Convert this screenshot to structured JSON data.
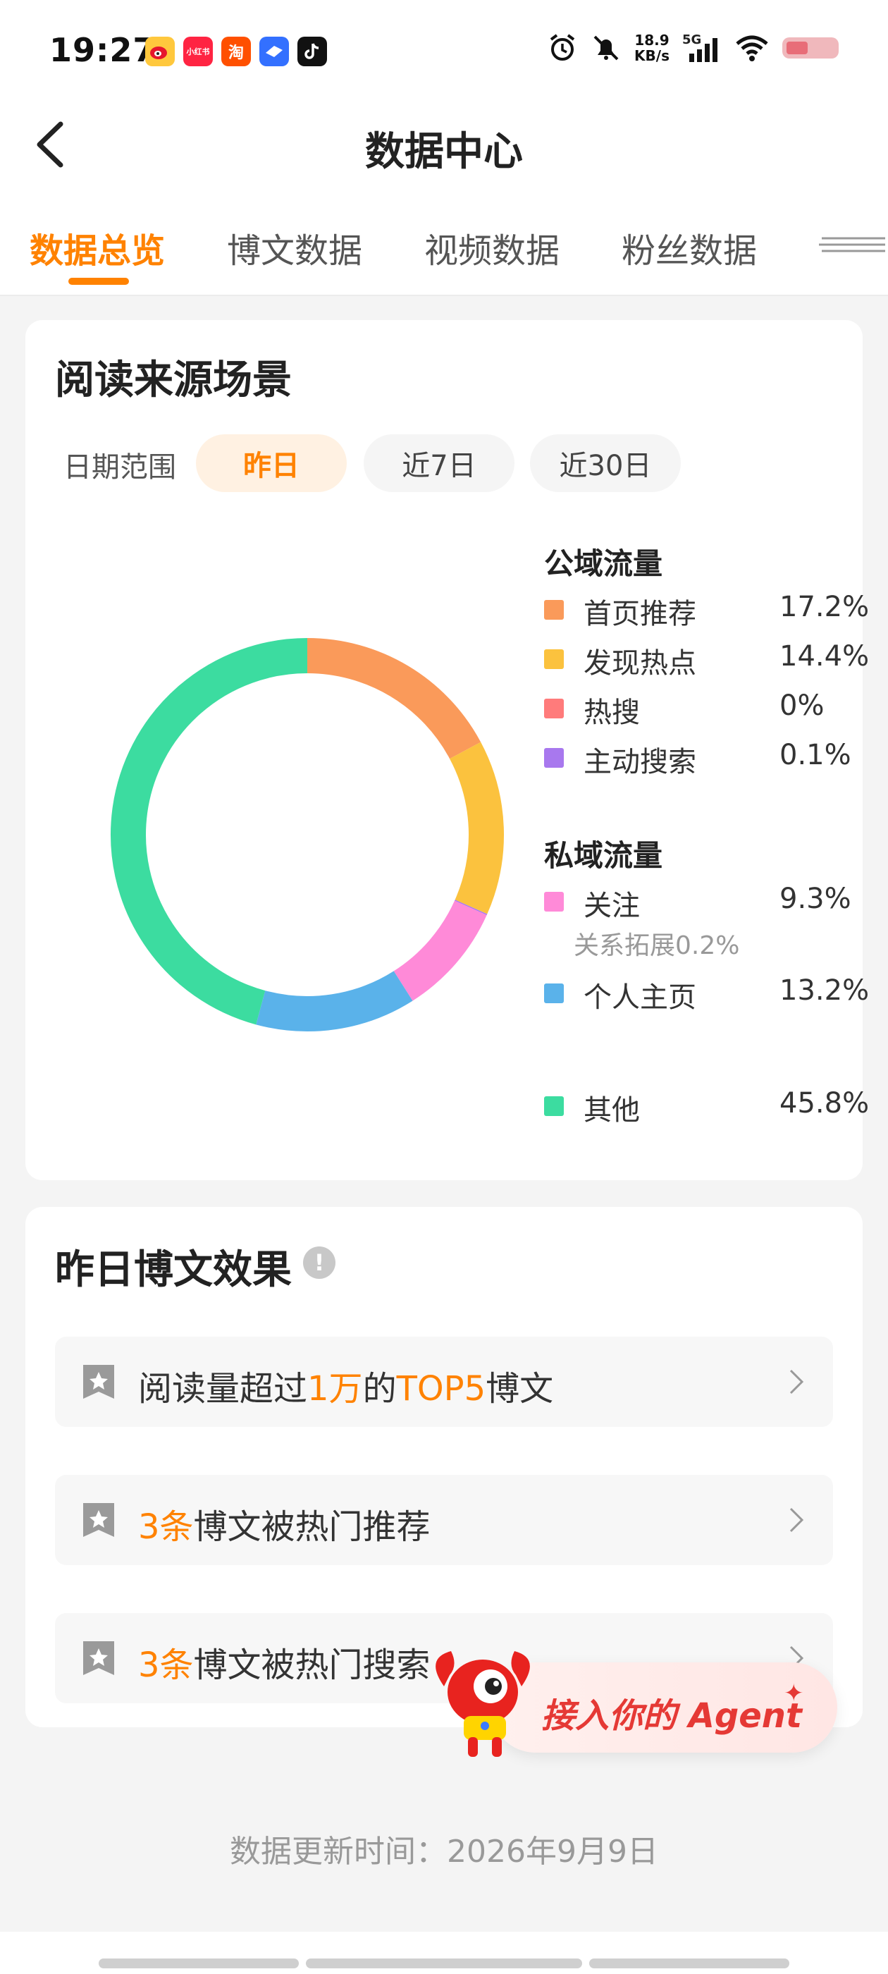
{
  "status_bar": {
    "time": "19:27",
    "apps": [
      "weibo-icon",
      "xiaohongshu-icon",
      "taobao-icon",
      "feishu-icon",
      "tiktok-icon"
    ],
    "net_speed_value": "18.9",
    "net_speed_unit": "KB/s",
    "network": "5G"
  },
  "header": {
    "title": "数据中心"
  },
  "tabs": [
    {
      "label": "数据总览",
      "active": true
    },
    {
      "label": "博文数据",
      "active": false
    },
    {
      "label": "视频数据",
      "active": false
    },
    {
      "label": "粉丝数据",
      "active": false
    }
  ],
  "read_source": {
    "title": "阅读来源场景",
    "date_range_label": "日期范围",
    "date_options": [
      {
        "label": "昨日",
        "active": true
      },
      {
        "label": "近7日",
        "active": false
      },
      {
        "label": "近30日",
        "active": false
      }
    ],
    "public_title": "公域流量",
    "private_title": "私域流量",
    "public_items": [
      {
        "label": "首页推荐",
        "value": "17.2%",
        "color": "#fa9a5a"
      },
      {
        "label": "发现热点",
        "value": "14.4%",
        "color": "#fbc23e"
      },
      {
        "label": "热搜",
        "value": "0%",
        "color": "#ff7b7b"
      },
      {
        "label": "主动搜索",
        "value": "0.1%",
        "color": "#a878ee"
      }
    ],
    "private_items": [
      {
        "label": "关注",
        "value": "9.3%",
        "color": "#ff8ad8"
      },
      {
        "label": "个人主页",
        "value": "13.2%",
        "color": "#5ab2ea"
      }
    ],
    "follow_sub": "关系拓展0.2%",
    "other_item": {
      "label": "其他",
      "value": "45.8%",
      "color": "#3cdca0"
    }
  },
  "chart_data": {
    "type": "pie",
    "title": "",
    "donut": true,
    "categories": [
      "首页推荐",
      "发现热点",
      "热搜",
      "主动搜索",
      "关注",
      "个人主页",
      "其他"
    ],
    "values": [
      17.2,
      14.4,
      0,
      0.1,
      9.3,
      13.2,
      45.8
    ],
    "colors": [
      "#fa9a5a",
      "#fbc23e",
      "#ff7b7b",
      "#a878ee",
      "#ff8ad8",
      "#5ab2ea",
      "#3cdca0"
    ],
    "legend": "right"
  },
  "yesterday_posts": {
    "title": "昨日博文效果",
    "rows": [
      {
        "parts": [
          "阅读量超过",
          "1万",
          "的",
          "TOP5",
          "博文"
        ]
      },
      {
        "parts": [
          "3条",
          "博文被热门推荐"
        ]
      },
      {
        "parts": [
          "3条",
          "博文被热门搜索"
        ]
      }
    ]
  },
  "agent_button": {
    "label": "接入你的 Agent"
  },
  "footer": {
    "update_time": "数据更新时间：2026年9月9日"
  }
}
